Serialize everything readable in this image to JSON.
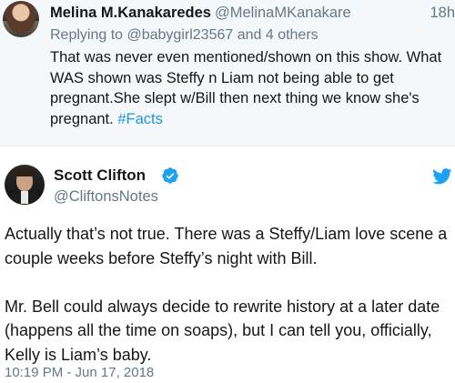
{
  "reply_tweet": {
    "display_name": "Melina M.Kanakaredes",
    "handle": "@MelinaMKanakare",
    "time": "18h",
    "replying_to": "Replying to @babygirl23567 and 4 others",
    "text": "That was never even mentioned/shown on this show. What WAS shown was Steffy n Liam not being able to get pregnant.She slept w/Bill then next thing we know she's pregnant. ",
    "hashtag": "#Facts",
    "hashtag_color": "#1b95e0",
    "background_color": "#f5f8fa"
  },
  "main_tweet": {
    "display_name": "Scott Clifton",
    "handle": "@CliftonsNotes",
    "verified_icon": "verified-badge-icon",
    "brand_icon": "twitter-bird-icon",
    "paragraphs": [
      "Actually that’s not true. There was a Steffy/Liam love scene a couple weeks before Steffy’s night with Bill.",
      "Mr. Bell could always decide to rewrite history at a later date (happens all the time on soaps), but I can tell you, officially, Kelly is Liam’s baby."
    ],
    "timestamp": "10:19 PM - Jun 17, 2018",
    "accent_color": "#1da1f2"
  }
}
